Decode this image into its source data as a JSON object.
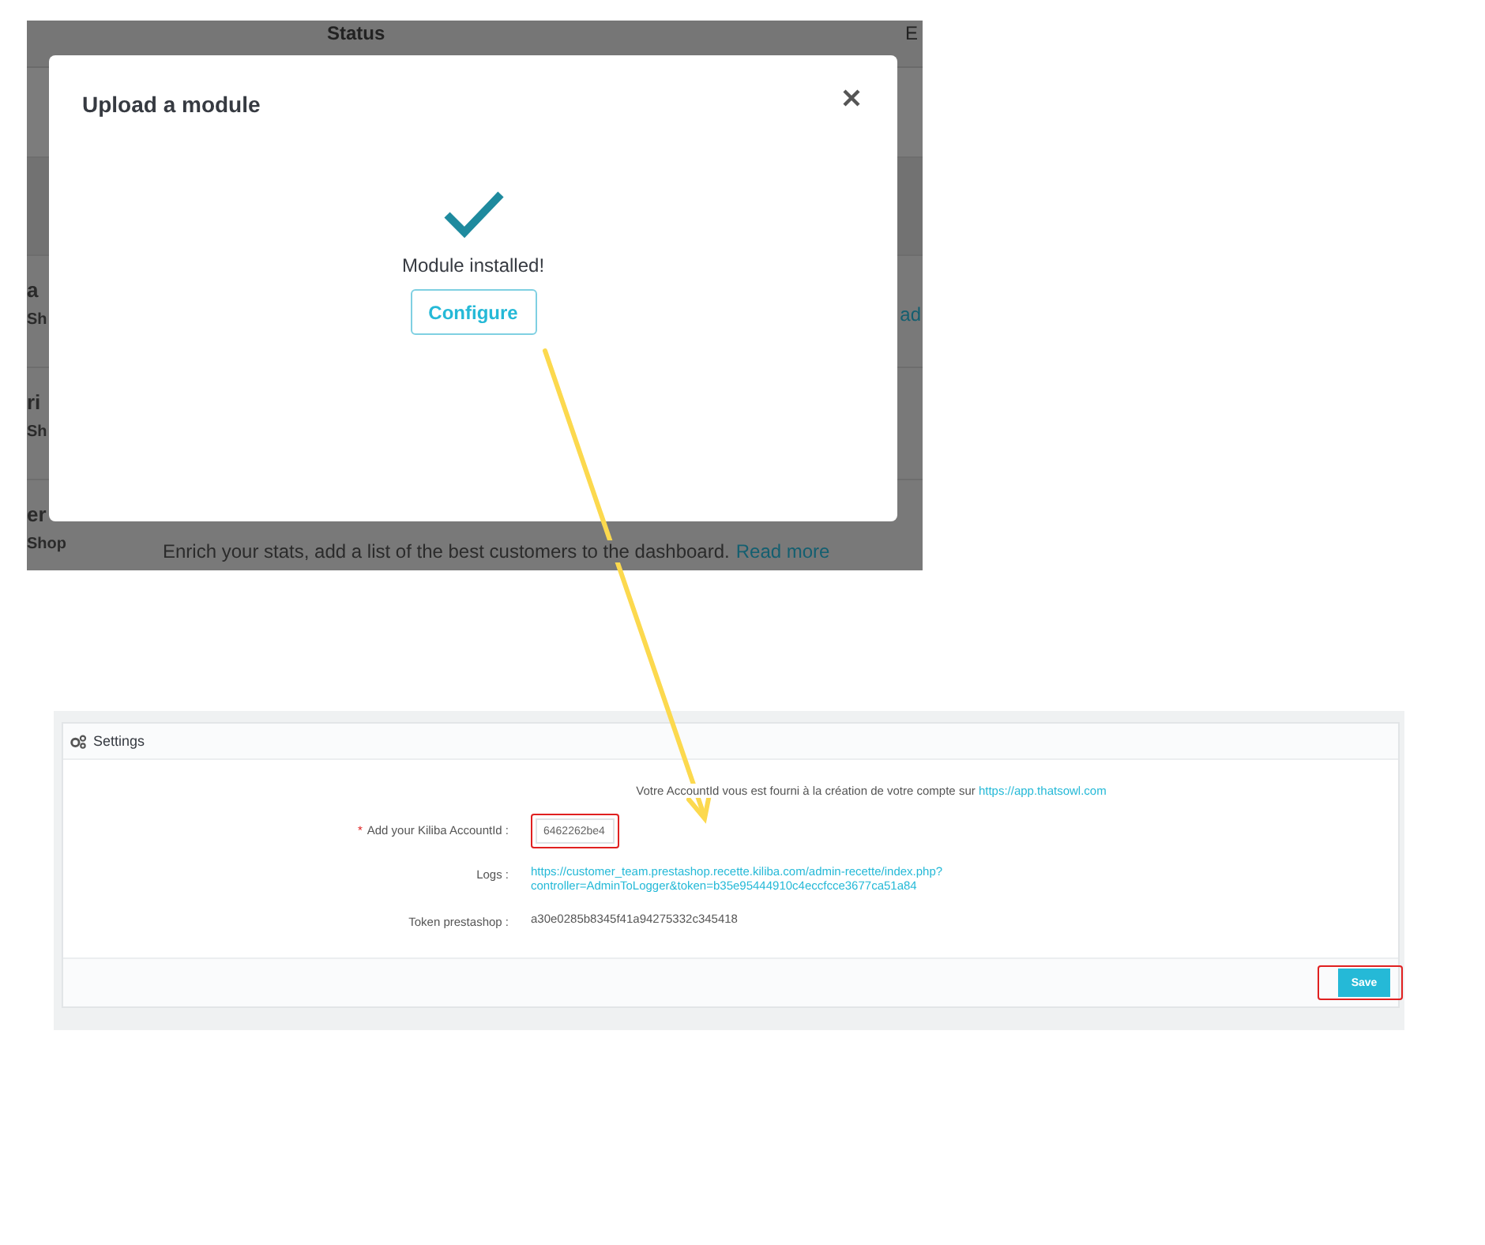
{
  "list_screenshot": {
    "column_header": "Status",
    "column_header_cut": "E",
    "rows": [
      {
        "title": "a",
        "subtitle": "Sh",
        "link": "ad"
      },
      {
        "title": "ri",
        "subtitle": "Sh"
      },
      {
        "title": "er",
        "subtitle": "Shop",
        "description": "Enrich your stats, add a list of the best customers to the dashboard.",
        "link": "Read more"
      }
    ]
  },
  "modal": {
    "title": "Upload a module",
    "message": "Module installed!",
    "button": "Configure"
  },
  "settings": {
    "title": "Settings",
    "intro": "Votre AccountId vous est fourni à la création de votre compte sur",
    "intro_link": "https://app.thatsowl.com",
    "fields": [
      {
        "kind": "input",
        "label": "Add your Kiliba AccountId :",
        "required_mark": "*",
        "value": "6462262be4",
        "highlighted": true
      },
      {
        "kind": "link",
        "label": "Logs :",
        "lines": [
          "https://customer_team.prestashop.recette.kiliba.com/admin-recette/index.php?",
          "controller=AdminToLogger&token=b35e95444910c4eccfcce3677ca51a84"
        ]
      },
      {
        "kind": "text",
        "label": "Token prestashop :",
        "value": "a30e0285b8345f41a94275332c345418"
      }
    ],
    "save_button": {
      "label": "Save",
      "highlighted": true
    }
  }
}
